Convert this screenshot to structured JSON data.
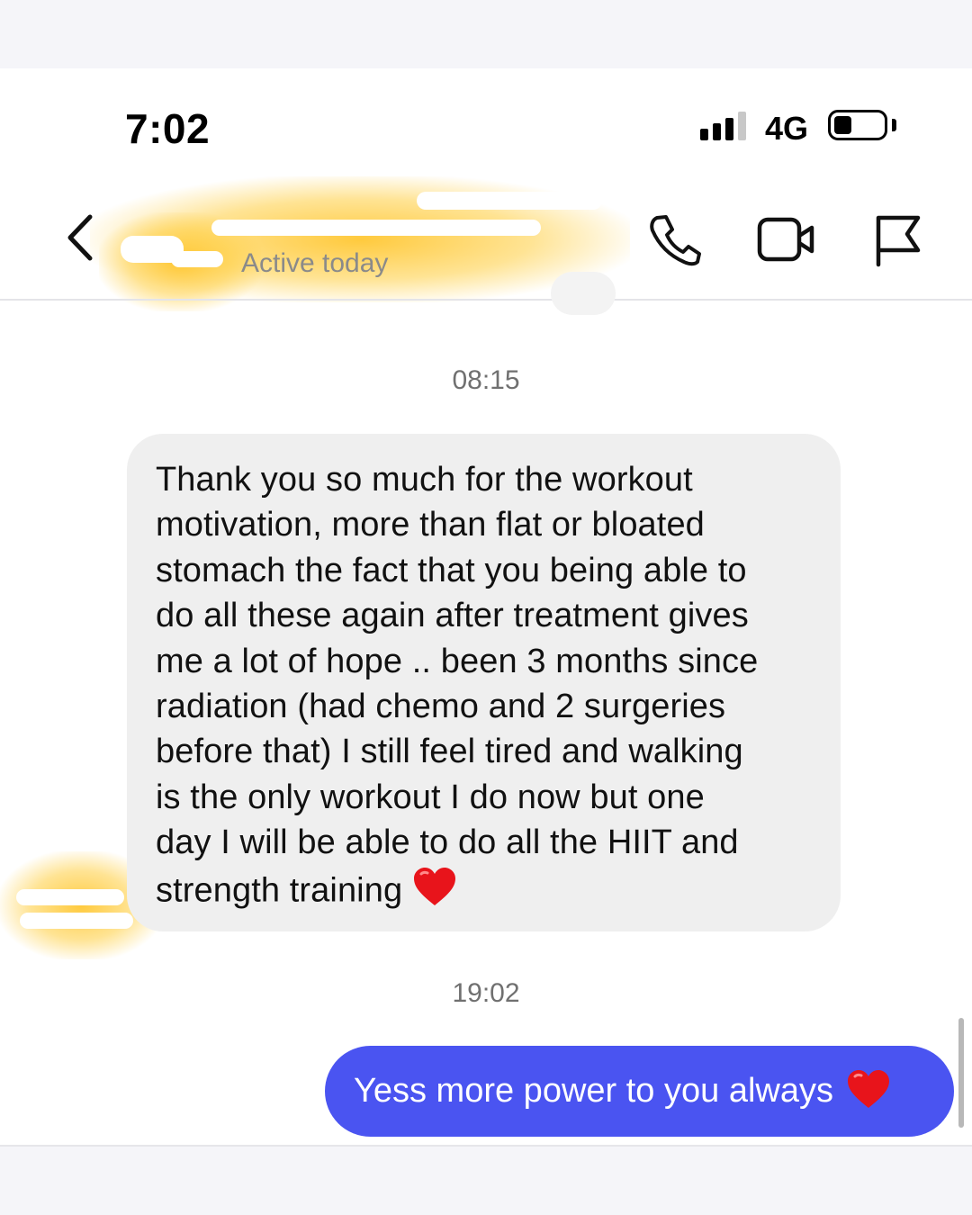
{
  "status_bar": {
    "time": "7:02",
    "network": "4G",
    "signal_bars_active": 3,
    "battery_level": 0.35
  },
  "header": {
    "contact_name": "",
    "status": "Active today",
    "icons": [
      "back-chevron-icon",
      "phone-icon",
      "video-camera-icon",
      "flag-icon"
    ]
  },
  "messages": [
    {
      "timestamp": "08:15",
      "direction": "incoming",
      "text": "Thank you so much for the workout\nmotivation, more than flat or bloated\nstomach the fact that you being able to\ndo all these again after treatment gives\nme a lot of hope .. been 3 months since\nradiation (had chemo and 2 surgeries\nbefore that) I still feel tired and walking\nis the only workout I do now but one\nday I will be able to do all the HIIT and\nstrength training",
      "emoji": "heart"
    },
    {
      "timestamp": "19:02",
      "direction": "outgoing",
      "text": "Yess more power to you always",
      "emoji": "heart"
    }
  ],
  "colors": {
    "outgoing_bubble": "#4a54f1",
    "incoming_bubble": "#efefef",
    "redaction_highlight": "#ffc428",
    "heart": "#e8141b"
  }
}
